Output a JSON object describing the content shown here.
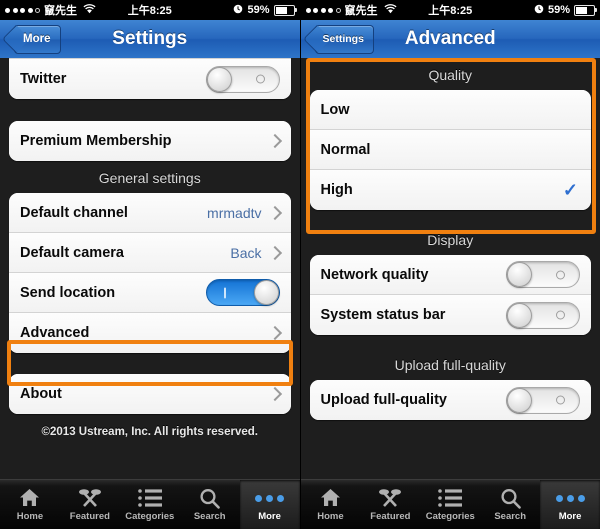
{
  "status_bar": {
    "signal_dots_filled": 4,
    "signal_dots_empty": 1,
    "carrier": "竄先生",
    "wifi_icon": "wifi-icon",
    "time": "上午8:25",
    "alarm_icon": "alarm-clock-icon",
    "battery_percent": "59%",
    "battery_level": 59
  },
  "left_screen": {
    "nav": {
      "back_label": "More",
      "title": "Settings"
    },
    "groups": [
      {
        "title": "",
        "rows": [
          {
            "label": "Twitter",
            "type": "toggle",
            "on": false
          }
        ]
      },
      {
        "title": "",
        "rows": [
          {
            "label": "Premium Membership",
            "type": "disclosure"
          }
        ]
      },
      {
        "title": "General settings",
        "rows": [
          {
            "label": "Default channel",
            "type": "disclosure",
            "value": "mrmadtv"
          },
          {
            "label": "Default camera",
            "type": "disclosure",
            "value": "Back"
          },
          {
            "label": "Send location",
            "type": "toggle",
            "on": true
          },
          {
            "label": "Advanced",
            "type": "disclosure",
            "highlighted": true
          }
        ]
      },
      {
        "title": "",
        "rows": [
          {
            "label": "About",
            "type": "disclosure"
          }
        ]
      }
    ],
    "copyright": "©2013 Ustream, Inc. All rights reserved."
  },
  "right_screen": {
    "nav": {
      "back_label": "Settings",
      "title": "Advanced"
    },
    "groups": [
      {
        "title": "Quality",
        "highlighted": true,
        "rows": [
          {
            "label": "Low",
            "type": "choice",
            "selected": false
          },
          {
            "label": "Normal",
            "type": "choice",
            "selected": false
          },
          {
            "label": "High",
            "type": "choice",
            "selected": true
          }
        ]
      },
      {
        "title": "Display",
        "rows": [
          {
            "label": "Network quality",
            "type": "toggle",
            "on": false
          },
          {
            "label": "System status bar",
            "type": "toggle",
            "on": false
          }
        ]
      },
      {
        "title": "Upload full-quality",
        "rows": [
          {
            "label": "Upload full-quality",
            "type": "toggle",
            "on": false
          }
        ]
      }
    ]
  },
  "tab_bar": {
    "items": [
      {
        "label": "Home",
        "icon": "home-icon",
        "active": false
      },
      {
        "label": "Featured",
        "icon": "crossed-utensils-icon",
        "active": false
      },
      {
        "label": "Categories",
        "icon": "list-icon",
        "active": false
      },
      {
        "label": "Search",
        "icon": "magnifier-icon",
        "active": false
      },
      {
        "label": "More",
        "icon": "three-dots-icon",
        "active": true
      }
    ]
  },
  "colors": {
    "highlight": "#f08010",
    "accent_blue": "#2f6fd0",
    "toggle_on": "#1372d4",
    "nav_blue": "#2767bd"
  }
}
